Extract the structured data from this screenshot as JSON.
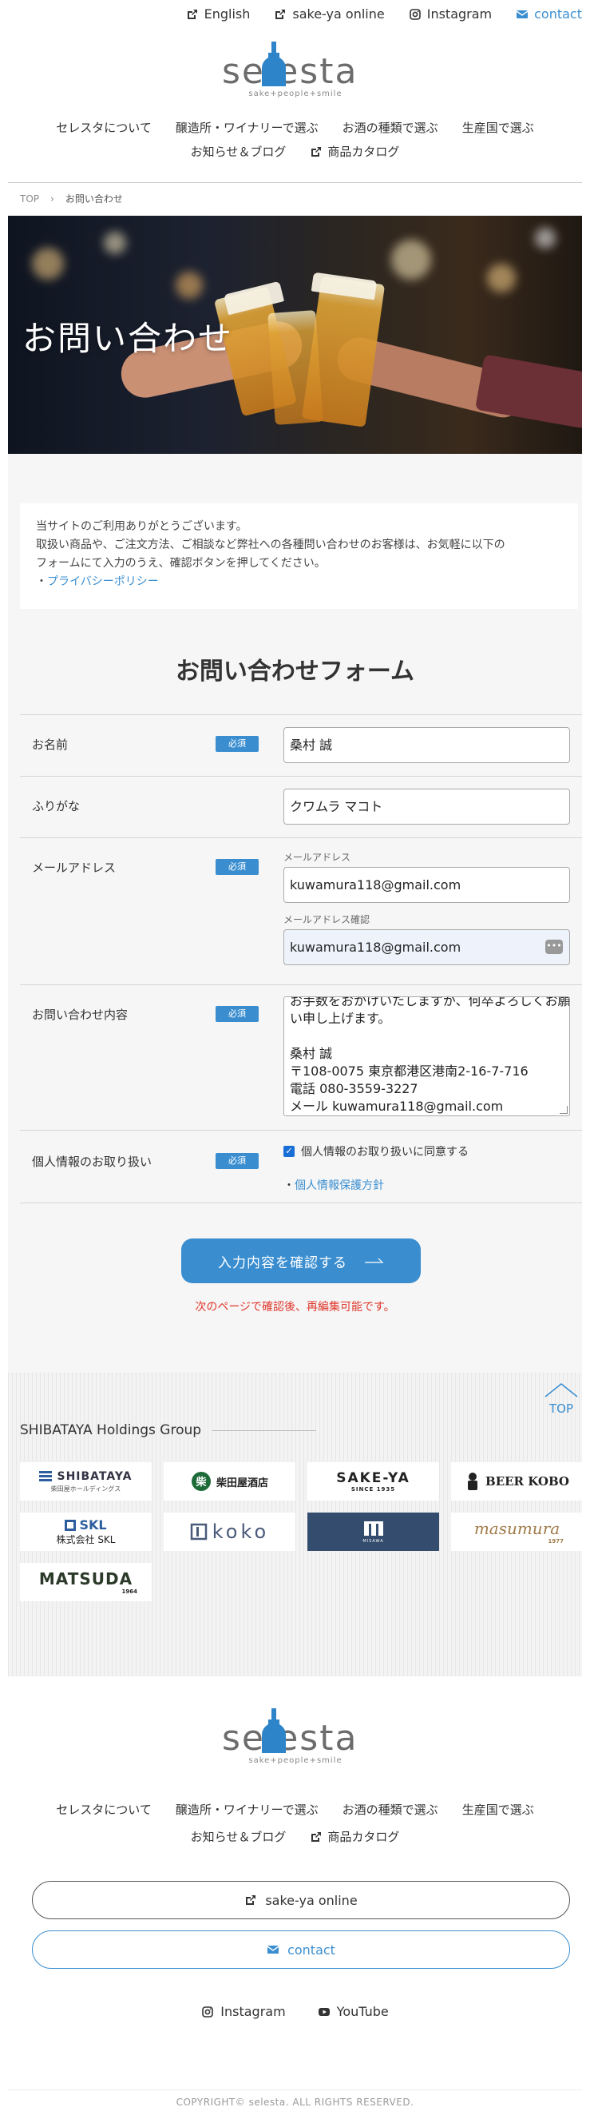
{
  "topbar": {
    "english": "English",
    "shop": "sake-ya online",
    "instagram": "Instagram",
    "contact": "contact"
  },
  "brand": {
    "name": "selesta",
    "tagline": "sake+people+smile"
  },
  "nav": {
    "items": [
      "セレスタについて",
      "醸造所・ワイナリーで選ぶ",
      "お酒の種類で選ぶ",
      "生産国で選ぶ"
    ],
    "news": "お知らせ＆ブログ",
    "catalog": "商品カタログ"
  },
  "breadcrumb": {
    "home": "TOP",
    "current": "お問い合わせ"
  },
  "hero": {
    "title": "お問い合わせ"
  },
  "intro": {
    "line1": "当サイトのご利用ありがとうございます。",
    "line2": "取扱い商品や、ご注文方法、ご相談など弊社への各種問い合わせのお客様は、お気軽に以下の",
    "line3": "フォームにて入力のうえ、確認ボタンを押してください。",
    "bullet": "・",
    "privacy_link": "プライバシーポリシー"
  },
  "form": {
    "title": "お問い合わせフォーム",
    "required_label": "必須",
    "name_label": "お名前",
    "name_value": "桑村 誠",
    "kana_label": "ふりがな",
    "kana_value": "クワムラ マコト",
    "email_label": "メールアドレス",
    "email_sublabel": "メールアドレス",
    "email_value": "kuwamura118@gmail.com",
    "email_confirm_sublabel": "メールアドレス確認",
    "email_confirm_value": "kuwamura118@gmail.com",
    "inquiry_label": "お問い合わせ内容",
    "inquiry_lines": [
      "お手数をおかけいたしますが、何卒よろしくお願",
      "い申し上げます。",
      "",
      "桑村 誠",
      "〒108-0075 東京都港区港南2-16-7-716",
      "電話 080-3559-3227",
      "メール kuwamura118@gmail.com"
    ],
    "privacy_label": "個人情報のお取り扱い",
    "agree_text": "個人情報のお取り扱いに同意する",
    "privacy_policy_link": "個人情報保護方針",
    "confirm_button": "入力内容を確認する",
    "confirm_note": "次のページで確認後、再編集可能です。"
  },
  "group": {
    "totop": "TOP",
    "title": "SHIBATAYA Holdings Group",
    "logos": [
      {
        "name": "SHIBATAYA",
        "sub": "柴田屋ホールディングス"
      },
      {
        "name": "柴田屋酒店"
      },
      {
        "name": "SAKE-YA",
        "sub": "SINCE 1935"
      },
      {
        "name": "BEER KOBO"
      },
      {
        "name": "SKL",
        "sub": "株式会社 SKL"
      },
      {
        "name": "koko"
      },
      {
        "name": "MISAWA"
      },
      {
        "name": "masumura",
        "sub": "1977"
      },
      {
        "name": "MATSUDA",
        "sub": "1964"
      }
    ]
  },
  "footer": {
    "shop_button": "sake-ya online",
    "contact_button": "contact",
    "instagram": "Instagram",
    "youtube": "YouTube",
    "copyright": "COPYRIGHT© selesta. ALL RIGHTS RESERVED."
  },
  "colors": {
    "accent": "#3a8ed0",
    "note": "#e0362b",
    "hero_dark": "#1d2230"
  }
}
